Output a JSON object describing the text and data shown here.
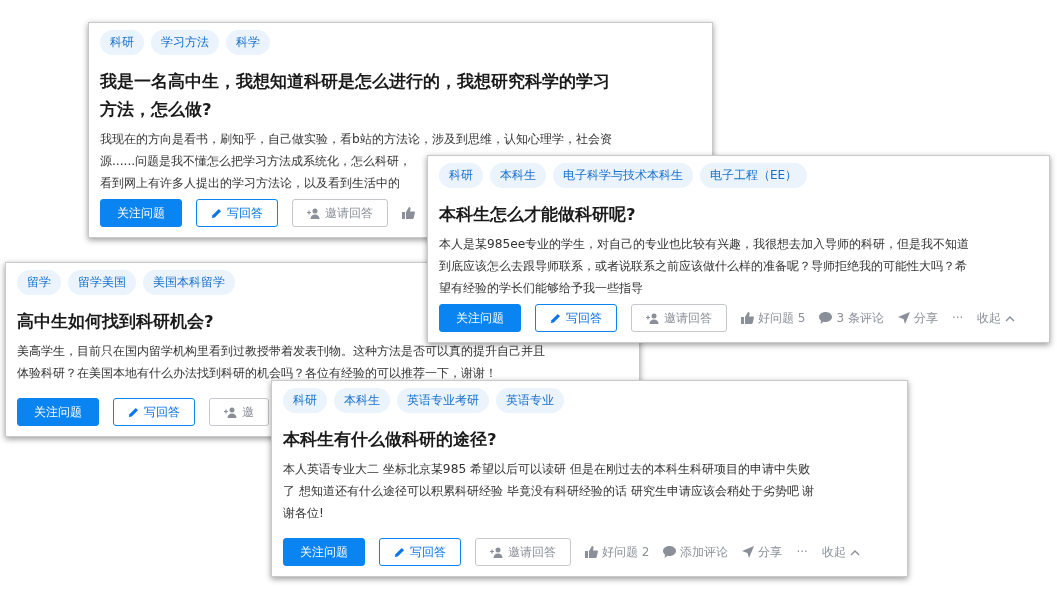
{
  "cards": [
    {
      "tags": [
        "科研",
        "学习方法",
        "科学"
      ],
      "title": "我是一名高中生，我想知道科研是怎么进行的，我想研究科学的学习方法，怎么做?",
      "description_lines": [
        "我现在的方向是看书，刷知乎，自己做实验，看b站的方法论，涉及到思维，认知心理学，社会资",
        "源......问题是我不懂怎么把学习方法成系统化，怎么科研，",
        "看到网上有许多人提出的学习方法论，以及看到生活中的"
      ],
      "buttons": [
        {
          "kind": "follow",
          "label": "关注问题"
        },
        {
          "kind": "write",
          "label": "写回答"
        },
        {
          "kind": "invite",
          "label": "邀请回答"
        }
      ],
      "meta": [
        {
          "kind": "like"
        }
      ]
    },
    {
      "tags": [
        "留学",
        "留学美国",
        "美国本科留学"
      ],
      "title": "高中生如何找到科研机会?",
      "description_lines": [
        "美高学生，目前只在国内留学机构里看到过教授带着发表刊物。这种方法是否可以真的提升自己并且",
        "体验科研？在美国本地有什么办法找到科研的机会吗？各位有经验的可以推荐一下，谢谢！"
      ],
      "buttons": [
        {
          "kind": "follow",
          "label": "关注问题"
        },
        {
          "kind": "write",
          "label": "写回答"
        },
        {
          "kind": "invite",
          "label": "邀"
        }
      ]
    },
    {
      "tags": [
        "科研",
        "本科生",
        "电子科学与技术本科生",
        "电子工程（EE）"
      ],
      "title": "本科生怎么才能做科研呢?",
      "description_lines": [
        "本人是某985ee专业的学生，对自己的专业也比较有兴趣，我很想去加入导师的科研，但是我不知道",
        "到底应该怎么去跟导师联系，或者说联系之前应该做什么样的准备呢？导师拒绝我的可能性大吗？希",
        "望有经验的学长们能够给予我一些指导"
      ],
      "buttons": [
        {
          "kind": "follow",
          "label": "关注问题"
        },
        {
          "kind": "write",
          "label": "写回答"
        },
        {
          "kind": "invite",
          "label": "邀请回答"
        }
      ],
      "meta": [
        {
          "kind": "like",
          "label": "好问题 5"
        },
        {
          "kind": "comment",
          "label": "3 条评论"
        },
        {
          "kind": "share",
          "label": "分享"
        },
        {
          "kind": "more",
          "label": "···"
        },
        {
          "kind": "collapse",
          "label": "收起"
        }
      ]
    },
    {
      "tags": [
        "科研",
        "本科生",
        "英语专业考研",
        "英语专业"
      ],
      "title": "本科生有什么做科研的途径?",
      "description_lines": [
        "本人英语专业大二 坐标北京某985 希望以后可以读研 但是在刚过去的本科生科研项目的申请中失败",
        "了 想知道还有什么途径可以积累科研经验 毕竟没有科研经验的话 研究生申请应该会稍处于劣势吧 谢",
        "谢各位!"
      ],
      "buttons": [
        {
          "kind": "follow",
          "label": "关注问题"
        },
        {
          "kind": "write",
          "label": "写回答"
        },
        {
          "kind": "invite",
          "label": "邀请回答"
        }
      ],
      "meta": [
        {
          "kind": "like",
          "label": "好问题 2"
        },
        {
          "kind": "comment",
          "label": "添加评论"
        },
        {
          "kind": "share",
          "label": "分享"
        },
        {
          "kind": "more",
          "label": "···"
        },
        {
          "kind": "collapse",
          "label": "收起"
        }
      ]
    }
  ]
}
